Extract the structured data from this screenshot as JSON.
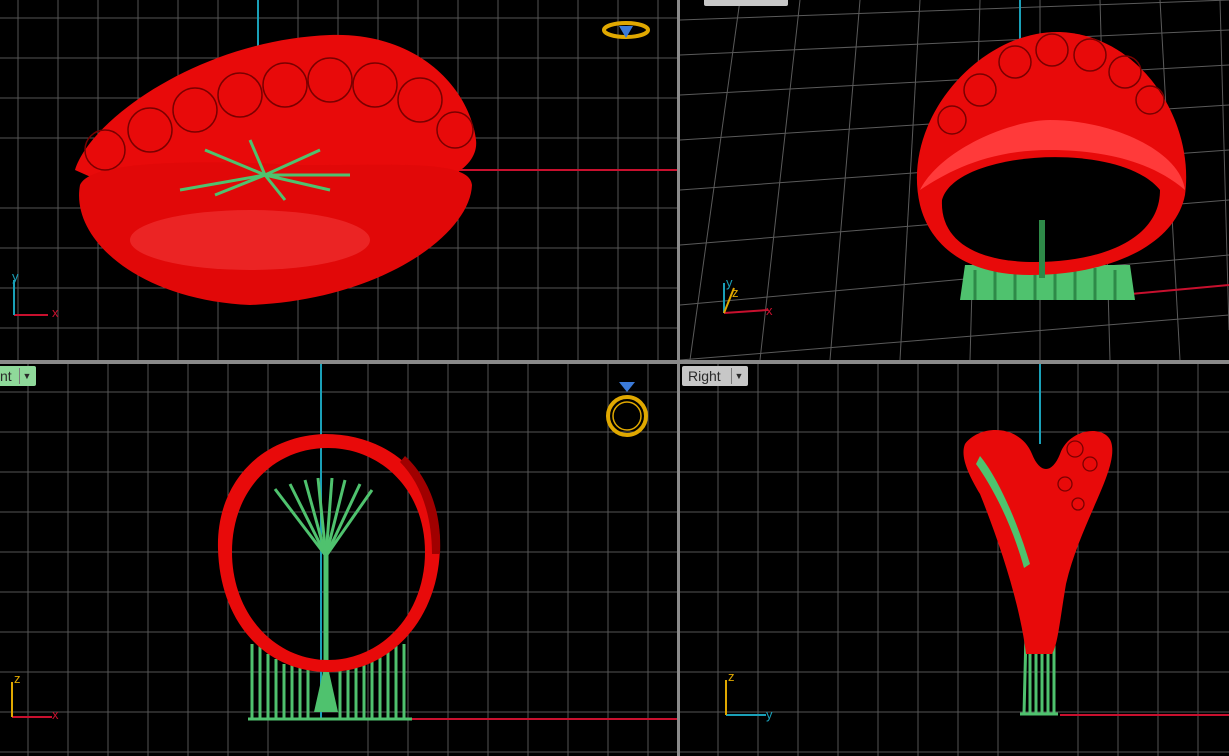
{
  "viewports": {
    "top": {
      "axis_x": "x",
      "axis_y": "y"
    },
    "perspective": {
      "tab_label": "",
      "axis_x": "x",
      "axis_y": "y",
      "axis_z": "z"
    },
    "front": {
      "tab_label": "nt",
      "axis_x": "x",
      "axis_z": "z"
    },
    "right": {
      "tab_label": "Right",
      "axis_y": "y",
      "axis_z": "z"
    }
  },
  "colors": {
    "background": "#000000",
    "grid": "#5a5a5a",
    "grid_major": "#7a7a7a",
    "x_axis": "#c8102e",
    "y_axis": "#1aa0b8",
    "model": "#e80a0a",
    "supports": "#4fc26e",
    "widget": "#e0a800",
    "gem": "#3b7ad8"
  },
  "icons": {
    "view_widget": "ring-view-widget-icon",
    "dropdown": "chevron-down-icon"
  }
}
